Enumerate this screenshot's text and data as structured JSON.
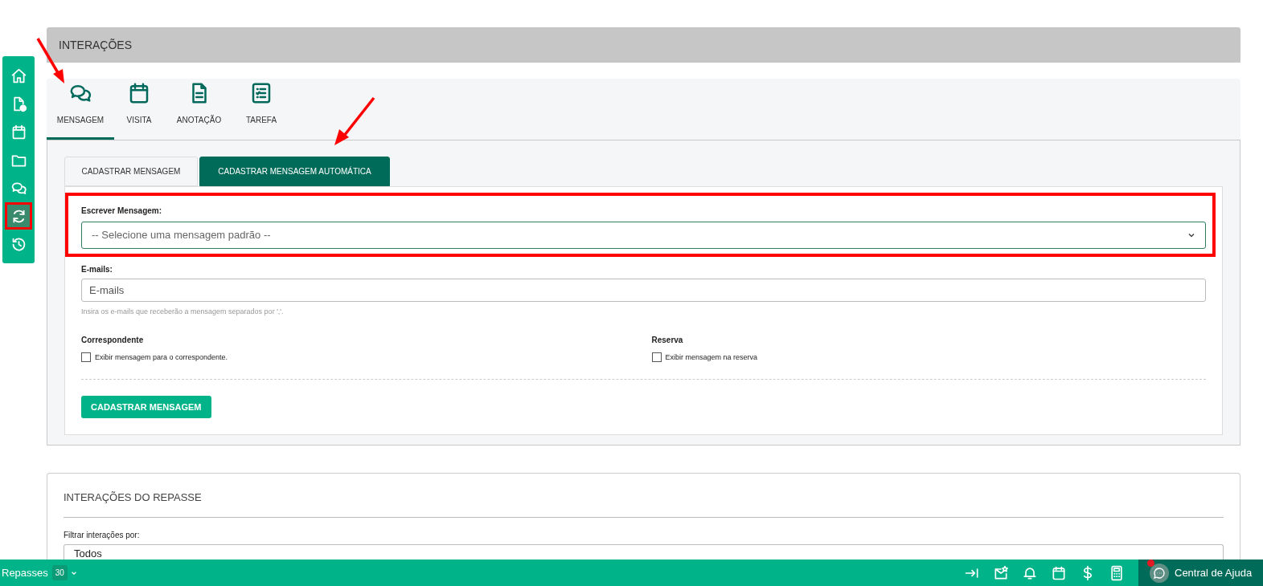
{
  "sidebar": {
    "items": [
      {
        "kind": "home",
        "selected": false
      },
      {
        "kind": "document-help",
        "selected": false
      },
      {
        "kind": "calendar",
        "selected": false
      },
      {
        "kind": "folder",
        "selected": false
      },
      {
        "kind": "chat",
        "selected": false
      },
      {
        "kind": "sync",
        "selected": true
      },
      {
        "kind": "history",
        "selected": false
      }
    ]
  },
  "section_header": "INTERAÇÕES",
  "interaction_tabs": [
    {
      "kind": "chat",
      "label": "MENSAGEM",
      "selected": true
    },
    {
      "kind": "calendar",
      "label": "VISITA",
      "selected": false
    },
    {
      "kind": "document",
      "label": "ANOTAÇÃO",
      "selected": false
    },
    {
      "kind": "checklist",
      "label": "TAREFA",
      "selected": false
    }
  ],
  "form_tabs": [
    {
      "label": "CADASTRAR MENSAGEM",
      "selected": false
    },
    {
      "label": "CADASTRAR MENSAGEM AUTOMÁTICA",
      "selected": true
    }
  ],
  "form": {
    "message_label": "Escrever Mensagem:",
    "message_select": {
      "placeholder": "-- Selecione uma mensagem padrão --"
    },
    "emails_label": "E-mails:",
    "emails_field": {
      "placeholder": "E-mails"
    },
    "emails_help": "Insira os e-mails que receberão a mensagem separados por ','.",
    "options": [
      {
        "heading": "Correspondente",
        "label": "Exibir mensagem para o correspondente.",
        "checked": false
      },
      {
        "heading": "Reserva",
        "label": "Exibir mensagem na reserva",
        "checked": false
      }
    ],
    "submit": "CADASTRAR MENSAGEM"
  },
  "history": {
    "title": "INTERAÇÕES DO REPASSE",
    "filter_label": "Filtrar interações por:",
    "filter_value": "Todos"
  },
  "bottom_bar": {
    "label": "Repasses",
    "count": "30",
    "tools": [
      {
        "kind": "collapse"
      },
      {
        "kind": "mail-star"
      },
      {
        "kind": "bell"
      },
      {
        "kind": "calendar"
      },
      {
        "kind": "dollar"
      },
      {
        "kind": "calculator"
      }
    ],
    "help": "Central de Ajuda",
    "help_notification": true
  }
}
